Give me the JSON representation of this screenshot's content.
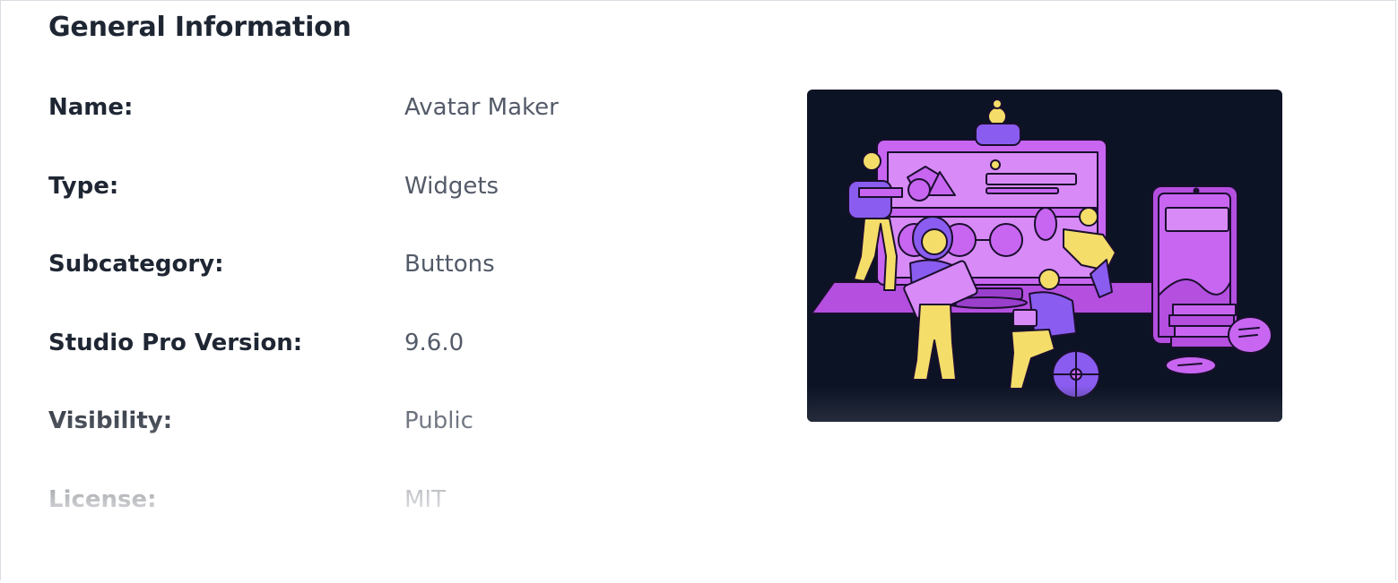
{
  "section": {
    "title": "General Information"
  },
  "info": [
    {
      "label": "Name:",
      "value": "Avatar Maker"
    },
    {
      "label": "Type:",
      "value": "Widgets"
    },
    {
      "label": "Subcategory:",
      "value": "Buttons"
    },
    {
      "label": "Studio Pro Version:",
      "value": "9.6.0"
    },
    {
      "label": "Visibility:",
      "value": "Public"
    },
    {
      "label": "License:",
      "value": "MIT"
    }
  ],
  "colors": {
    "heading": "#1f2633",
    "value_text": "#535a68",
    "illustration_bg": "#0c1324",
    "illustration_purple": "#c866f2",
    "illustration_yellow": "#f5dd6a"
  }
}
